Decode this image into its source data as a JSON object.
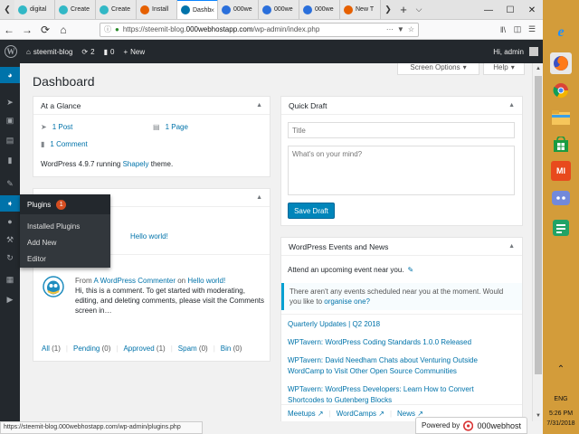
{
  "browser": {
    "tabs": [
      {
        "label": "digital",
        "color": "#32b8c6",
        "active": false
      },
      {
        "label": "Create",
        "color": "#32b8c6",
        "active": false
      },
      {
        "label": "Create",
        "color": "#32b8c6",
        "active": false
      },
      {
        "label": "Install",
        "color": "#e66000",
        "active": false
      },
      {
        "label": "Dashb",
        "color": "#0073aa",
        "active": true
      },
      {
        "label": "000we",
        "color": "#2a6fdb",
        "active": false
      },
      {
        "label": "000we",
        "color": "#2a6fdb",
        "active": false
      },
      {
        "label": "000we",
        "color": "#2a6fdb",
        "active": false
      },
      {
        "label": "New T",
        "color": "#e66000",
        "active": false
      }
    ],
    "url_prefix": "https://steemit-blog.",
    "url_domain": "000webhostapp.com",
    "url_path": "/wp-admin/index.php",
    "status_url": "https://steemit-blog.000webhostapp.com/wp-admin/plugins.php"
  },
  "adminbar": {
    "site_name": "steemit-blog",
    "updates_count": "2",
    "comments_count": "0",
    "new_label": "New",
    "greeting": "Hi, admin"
  },
  "screen": {
    "screen_options": "Screen Options",
    "help": "Help",
    "title": "Dashboard"
  },
  "plugins_menu": {
    "label": "Plugins",
    "badge": "1",
    "items": [
      "Installed Plugins",
      "Add New",
      "Editor"
    ]
  },
  "at_a_glance": {
    "title": "At a Glance",
    "posts": "1 Post",
    "pages": "1 Page",
    "comments": "1 Comment",
    "version_text": "WordPress 4.9.7 running",
    "theme_name": "Shapely",
    "theme_suffix": "theme."
  },
  "activity": {
    "hello_link": "Hello world!",
    "comment_from": "From",
    "commenter": "A WordPress Commenter",
    "on": "on",
    "post_link": "Hello world!",
    "comment_text": "Hi, this is a comment. To get started with moderating, editing, and deleting comments, please visit the Comments screen in…",
    "filters": [
      {
        "label": "All",
        "count": "(1)"
      },
      {
        "label": "Pending",
        "count": "(0)"
      },
      {
        "label": "Approved",
        "count": "(1)"
      },
      {
        "label": "Spam",
        "count": "(0)"
      },
      {
        "label": "Bin",
        "count": "(0)"
      }
    ]
  },
  "quick_draft": {
    "title": "Quick Draft",
    "title_placeholder": "Title",
    "content_placeholder": "What's on your mind?",
    "save_label": "Save Draft"
  },
  "events": {
    "title": "WordPress Events and News",
    "attend_text": "Attend an upcoming event near you.",
    "notice_text": "There aren't any events scheduled near you at the moment. Would you like to",
    "organise_link": "organise one?",
    "news": [
      "Quarterly Updates | Q2 2018",
      "WPTavern: WordPress Coding Standards 1.0.0 Released",
      "WPTavern: David Needham Chats about Venturing Outside WordCamp to Visit Other Open Source Communities",
      "WPTavern: WordPress Developers: Learn How to Convert Shortcodes to Gutenberg Blocks"
    ],
    "footer_links": [
      "Meetups",
      "WordCamps",
      "News"
    ]
  },
  "powered_by": {
    "prefix": "Powered by",
    "brand": "000webhost"
  },
  "taskbar": {
    "lang": "ENG",
    "time": "5:26 PM",
    "date": "7/31/2018",
    "mi_label": "MI"
  }
}
